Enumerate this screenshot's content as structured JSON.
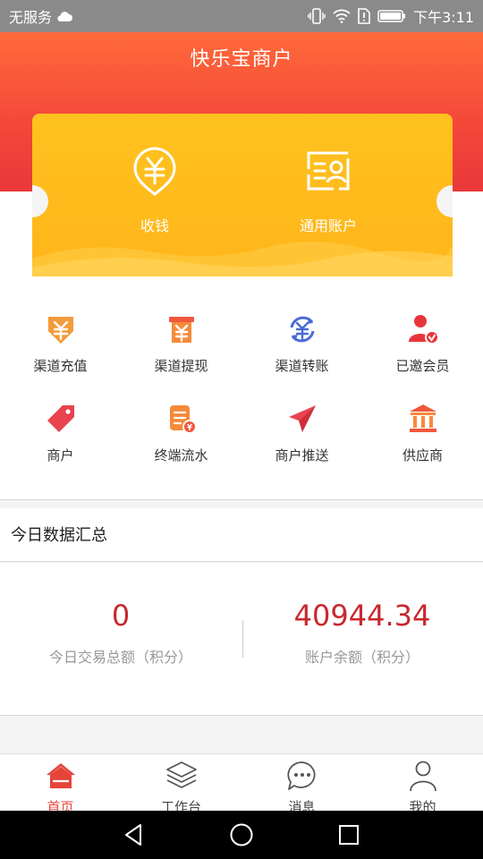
{
  "status_bar": {
    "carrier": "无服务",
    "time": "下午3:11"
  },
  "header": {
    "title": "快乐宝商户"
  },
  "card": {
    "items": [
      {
        "label": "收钱",
        "icon": "yuan-qr-icon"
      },
      {
        "label": "通用账户",
        "icon": "account-card-icon"
      }
    ]
  },
  "grid": {
    "items": [
      {
        "label": "渠道充值",
        "icon": "recharge-icon"
      },
      {
        "label": "渠道提现",
        "icon": "withdraw-icon"
      },
      {
        "label": "渠道转账",
        "icon": "transfer-icon"
      },
      {
        "label": "已邀会员",
        "icon": "invited-member-icon"
      },
      {
        "label": "商户",
        "icon": "merchant-tag-icon"
      },
      {
        "label": "终端流水",
        "icon": "terminal-flow-icon"
      },
      {
        "label": "商户推送",
        "icon": "push-icon"
      },
      {
        "label": "供应商",
        "icon": "supplier-icon"
      }
    ]
  },
  "summary": {
    "title": "今日数据汇总",
    "stats": [
      {
        "value": "0",
        "label": "今日交易总额（积分）"
      },
      {
        "value": "40944.34",
        "label": "账户余额（积分）"
      }
    ]
  },
  "tabbar": {
    "items": [
      {
        "label": "首页",
        "icon": "home-icon",
        "active": true
      },
      {
        "label": "工作台",
        "icon": "layers-icon",
        "active": false
      },
      {
        "label": "消息",
        "icon": "message-icon",
        "active": false
      },
      {
        "label": "我的",
        "icon": "user-icon",
        "active": false
      }
    ]
  },
  "colors": {
    "header_top": "#ff6a3a",
    "header_bottom": "#e8353b",
    "card": "#ffb51a",
    "accent_red": "#c8282e",
    "tab_active": "#e5443a"
  }
}
